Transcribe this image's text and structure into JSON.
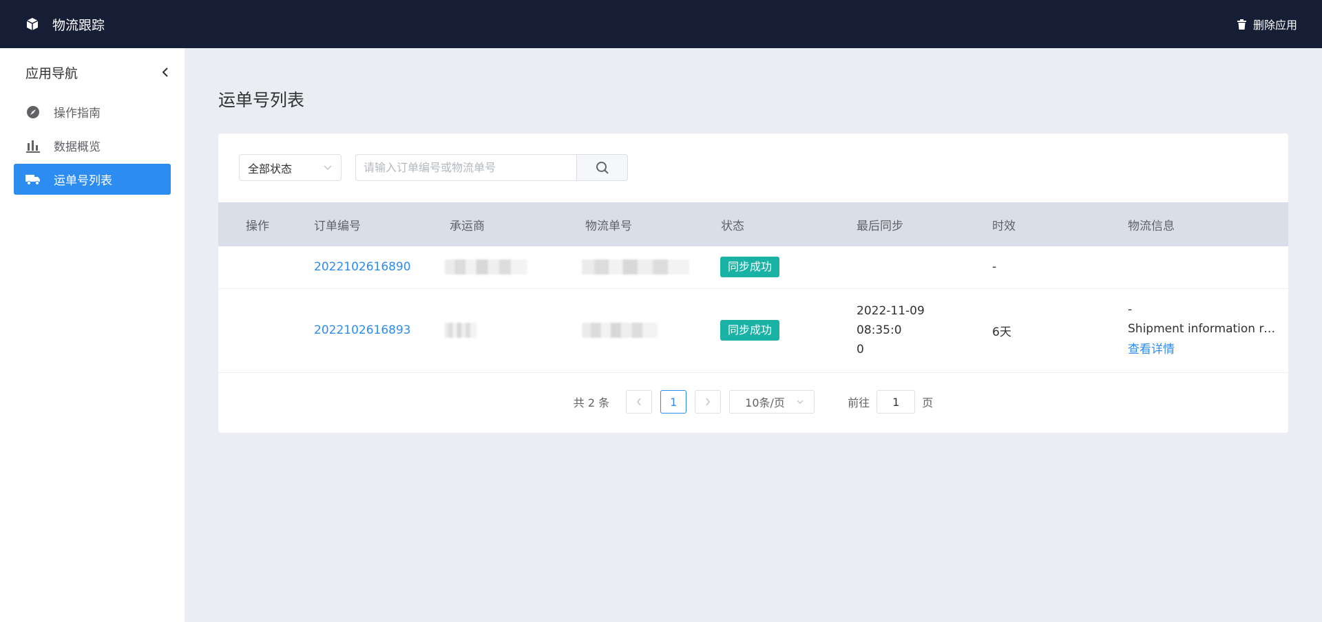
{
  "topbar": {
    "app_title": "物流跟踪",
    "app_icon": "cube-icon",
    "delete_label": "删除应用",
    "delete_icon": "trash-icon"
  },
  "sidebar": {
    "header": "应用导航",
    "items": [
      {
        "label": "操作指南",
        "icon": "compass-icon",
        "active": false
      },
      {
        "label": "数据概览",
        "icon": "bar-chart-icon",
        "active": false
      },
      {
        "label": "运单号列表",
        "icon": "truck-icon",
        "active": true
      }
    ]
  },
  "main": {
    "title": "运单号列表",
    "filter": {
      "status_selected": "全部状态"
    },
    "search": {
      "placeholder": "请输入订单编号或物流单号",
      "value": ""
    },
    "table": {
      "columns": [
        "操作",
        "订单编号",
        "承运商",
        "物流单号",
        "状态",
        "最后同步",
        "时效",
        "物流信息"
      ],
      "rows": [
        {
          "order_no": "2022102616890",
          "status": "同步成功",
          "last_sync": "",
          "duration": "-",
          "info_dash": "",
          "info_text": "",
          "info_link": ""
        },
        {
          "order_no": "2022102616893",
          "status": "同步成功",
          "last_sync": "2022-11-09 08:35:0",
          "last_sync_wrap": "0",
          "duration": "6天",
          "info_dash": "-",
          "info_text": "Shipment information re...",
          "info_link": "查看详情"
        }
      ]
    },
    "pagination": {
      "total_text": "共 2 条",
      "current_page": "1",
      "page_size": "10条/页",
      "goto_label": "前往",
      "goto_value": "1",
      "page_suffix": "页"
    }
  },
  "colors": {
    "topbar_bg": "#151e35",
    "accent": "#2d8cf0",
    "success_tag": "#19b2a4",
    "page_bg": "#eaedf1",
    "table_header_bg": "#d9dee8"
  }
}
